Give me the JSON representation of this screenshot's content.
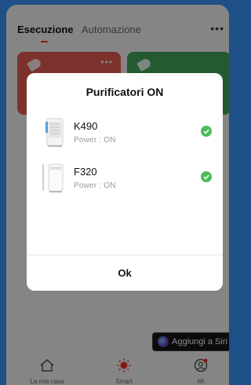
{
  "header": {
    "tabs": [
      {
        "label": "Esecuzione",
        "active": true
      },
      {
        "label": "Automazione",
        "active": false
      }
    ],
    "more_icon": "more-icon"
  },
  "cards": [
    {
      "color": "#e35b52",
      "icon": "tag-icon"
    },
    {
      "color": "#41a55a",
      "icon": "tag-icon"
    }
  ],
  "siri_button": {
    "label": "Aggiungi a Siri",
    "icon": "siri-icon"
  },
  "bottom_nav": [
    {
      "label": "La mia casa",
      "icon": "home-icon"
    },
    {
      "label": "Smart",
      "icon": "sun-icon"
    },
    {
      "label": "Mi",
      "icon": "user-icon"
    }
  ],
  "dialog": {
    "title": "Purificatori ON",
    "devices": [
      {
        "name": "K490",
        "status": "Power : ON",
        "checked": true
      },
      {
        "name": "F320",
        "status": "Power : ON",
        "checked": true
      }
    ],
    "ok_label": "Ok"
  },
  "colors": {
    "accent": "#e8342b",
    "check": "#4cbb5a",
    "background": "#1e4f86"
  }
}
